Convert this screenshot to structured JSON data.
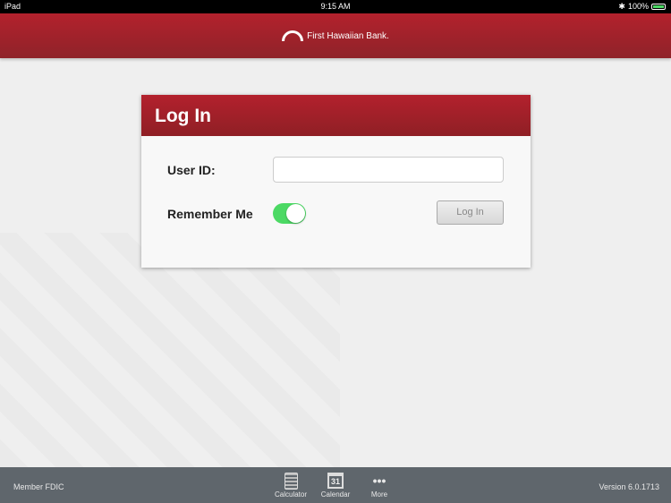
{
  "status": {
    "device": "iPad",
    "time": "9:15 AM",
    "battery": "100%"
  },
  "header": {
    "brand": "First Hawaiian Bank."
  },
  "login": {
    "title": "Log In",
    "user_id_label": "User ID:",
    "user_id_value": "",
    "remember_label": "Remember Me",
    "remember_on": true,
    "button": "Log In"
  },
  "footer": {
    "left": "Member FDIC",
    "right": "Version 6.0.1713",
    "tabs": [
      {
        "label": "Calculator"
      },
      {
        "label": "Calendar",
        "day": "31"
      },
      {
        "label": "More"
      }
    ]
  }
}
